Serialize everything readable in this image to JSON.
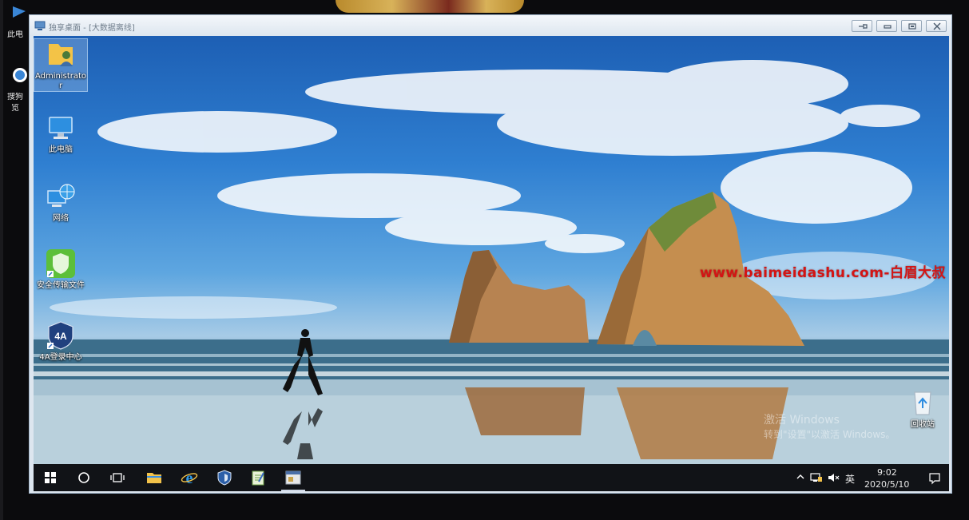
{
  "window": {
    "title": "独享桌面 - [大数据离线]",
    "controls": [
      "pin",
      "minimize",
      "restore",
      "close"
    ]
  },
  "host_desktop": {
    "icons": [
      {
        "label": "此电",
        "icon": "computer-icon"
      },
      {
        "label": "搜狗",
        "icon": "sogou-icon"
      },
      {
        "label": "览",
        "icon": "sogou-icon"
      }
    ]
  },
  "desktop": {
    "icons": [
      {
        "id": "administrator",
        "label": "Administrator",
        "icon": "user-folder-icon"
      },
      {
        "id": "this-pc",
        "label": "此电脑",
        "icon": "computer-icon"
      },
      {
        "id": "network",
        "label": "网络",
        "icon": "network-icon"
      },
      {
        "id": "secure-file",
        "label": "安全传输文件",
        "icon": "shield-folder-icon"
      },
      {
        "id": "4a-center",
        "label": "4A登录中心",
        "icon": "4a-shield-icon"
      },
      {
        "id": "recycle-bin",
        "label": "回收站",
        "icon": "recycle-bin-icon"
      }
    ],
    "watermark": "www.baimeidashu.com-白眉大叔",
    "activation": {
      "line1": "激活 Windows",
      "line2": "转到\"设置\"以激活 Windows。"
    }
  },
  "taskbar": {
    "items": [
      {
        "name": "start",
        "icon": "windows-logo-icon"
      },
      {
        "name": "search",
        "icon": "search-circle-icon"
      },
      {
        "name": "task-view",
        "icon": "task-view-icon"
      },
      {
        "name": "file-explorer",
        "icon": "folder-icon"
      },
      {
        "name": "internet-explorer",
        "icon": "ie-icon"
      },
      {
        "name": "security-app",
        "icon": "shield-icon"
      },
      {
        "name": "notepad",
        "icon": "notepad-icon"
      },
      {
        "name": "remote-app",
        "icon": "app-window-icon",
        "active": true
      }
    ],
    "tray": {
      "ime": "英",
      "time": "9:02",
      "date": "2020/5/10"
    }
  },
  "colors": {
    "taskbar": "#111317",
    "watermark": "#d41414",
    "window_frame": "#dde6ef"
  }
}
